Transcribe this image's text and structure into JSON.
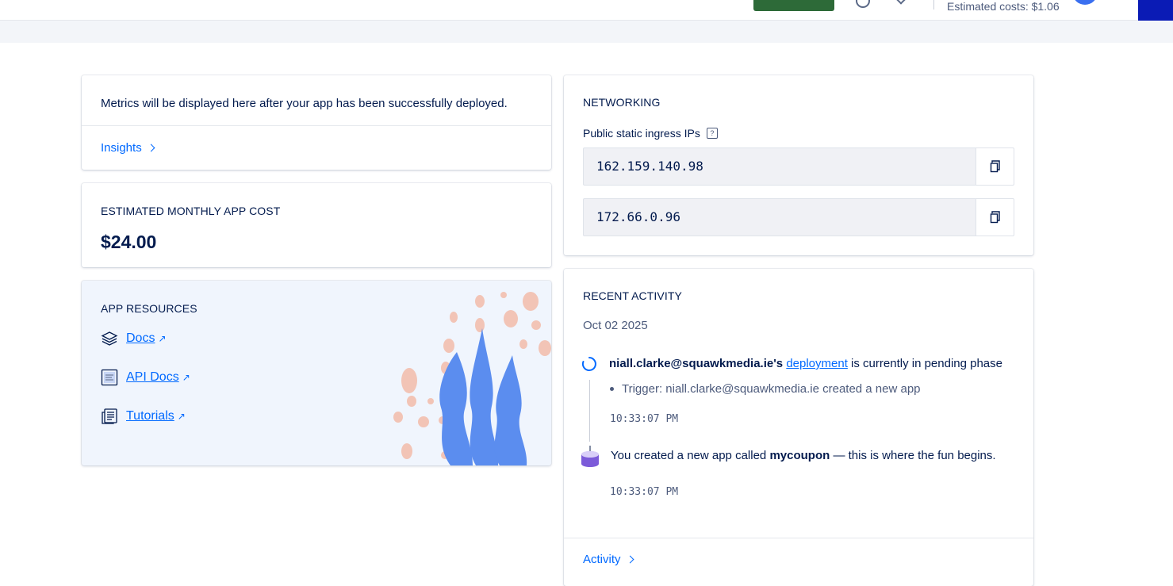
{
  "header": {
    "estimated_costs": "Estimated costs: $1.06"
  },
  "metrics": {
    "message": "Metrics will be displayed here after your app has been successfully deployed.",
    "insights_link": "Insights"
  },
  "cost": {
    "title": "ESTIMATED MONTHLY APP COST",
    "amount": "$24.00"
  },
  "resources": {
    "title": "APP RESOURCES",
    "items": [
      {
        "label": "Docs",
        "icon": "layers-icon"
      },
      {
        "label": "API Docs",
        "icon": "api-doc-icon"
      },
      {
        "label": "Tutorials",
        "icon": "tutorial-icon"
      }
    ],
    "external_arrow": "↗"
  },
  "networking": {
    "title": "NETWORKING",
    "subtitle": "Public static ingress IPs",
    "help": "?",
    "ips": [
      "162.159.140.98",
      "172.66.0.96"
    ]
  },
  "activity": {
    "title": "RECENT ACTIVITY",
    "date": "Oct 02 2025",
    "event1": {
      "user": "niall.clarke@squawkmedia.ie's",
      "link": "deployment",
      "text": "is currently in pending phase",
      "trigger": "Trigger: niall.clarke@squawkmedia.ie created a new app",
      "time": "10:33:07 PM"
    },
    "event2": {
      "prefix": "You created a new app called",
      "app": "mycoupon",
      "suffix": "— this is where the fun begins.",
      "time": "10:33:07 PM"
    },
    "activity_link": "Activity"
  },
  "colors": {
    "accent": "#0069ff",
    "text": "#031b4e",
    "deploy_button": "#2d6a38",
    "illustration_blue": "#5b8def",
    "illustration_pink": "#f2c4b6"
  }
}
